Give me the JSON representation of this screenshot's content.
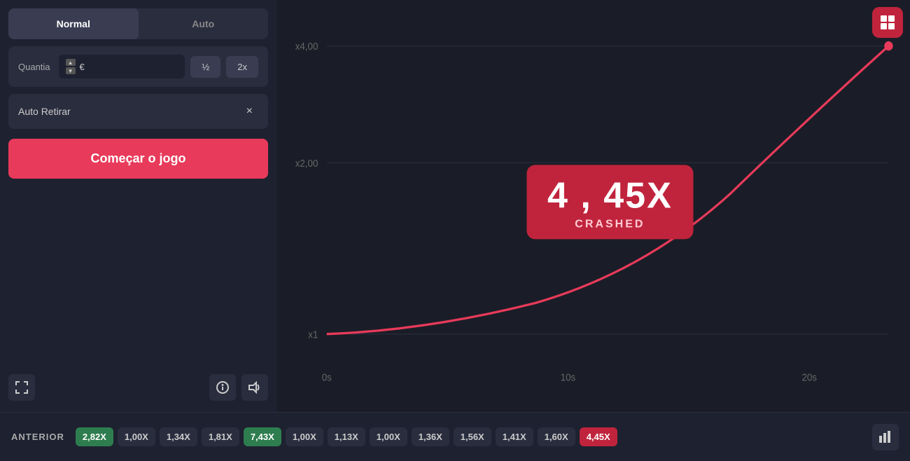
{
  "leftPanel": {
    "modeTabs": [
      {
        "label": "Normal",
        "active": true
      },
      {
        "label": "Auto",
        "active": false
      }
    ],
    "quantiaLabel": "Quantia",
    "quantiaPlaceholder": "",
    "currencySymbol": "€",
    "halfBtn": "½",
    "doubleBtn": "2x",
    "autoRetirarLabel": "Auto Retirar",
    "closeBtn": "×",
    "startBtnLabel": "Começar o jogo"
  },
  "chart": {
    "yLabels": [
      "x4,00",
      "x2,00",
      "x1"
    ],
    "xLabels": [
      "0s",
      "10s",
      "20s"
    ],
    "crashMultiplier": "4 , 45X",
    "crashLabel": "CRASHED",
    "rocketIcon": "grid"
  },
  "bottomBar": {
    "anteriorLabel": "ANTERIOR",
    "history": [
      {
        "value": "2,82X",
        "type": "green"
      },
      {
        "value": "1,00X",
        "type": "gray"
      },
      {
        "value": "1,34X",
        "type": "gray"
      },
      {
        "value": "1,81X",
        "type": "gray"
      },
      {
        "value": "7,43X",
        "type": "green"
      },
      {
        "value": "1,00X",
        "type": "gray"
      },
      {
        "value": "1,13X",
        "type": "gray"
      },
      {
        "value": "1,00X",
        "type": "gray"
      },
      {
        "value": "1,36X",
        "type": "gray"
      },
      {
        "value": "1,56X",
        "type": "gray"
      },
      {
        "value": "1,41X",
        "type": "gray"
      },
      {
        "value": "1,60X",
        "type": "gray"
      },
      {
        "value": "4,45X",
        "type": "red-tag"
      }
    ]
  },
  "bottomIcons": {
    "fullscreenIcon": "⛶",
    "infoIcon": "ℹ",
    "soundIcon": "🔊",
    "barchartIcon": "▐▌"
  }
}
